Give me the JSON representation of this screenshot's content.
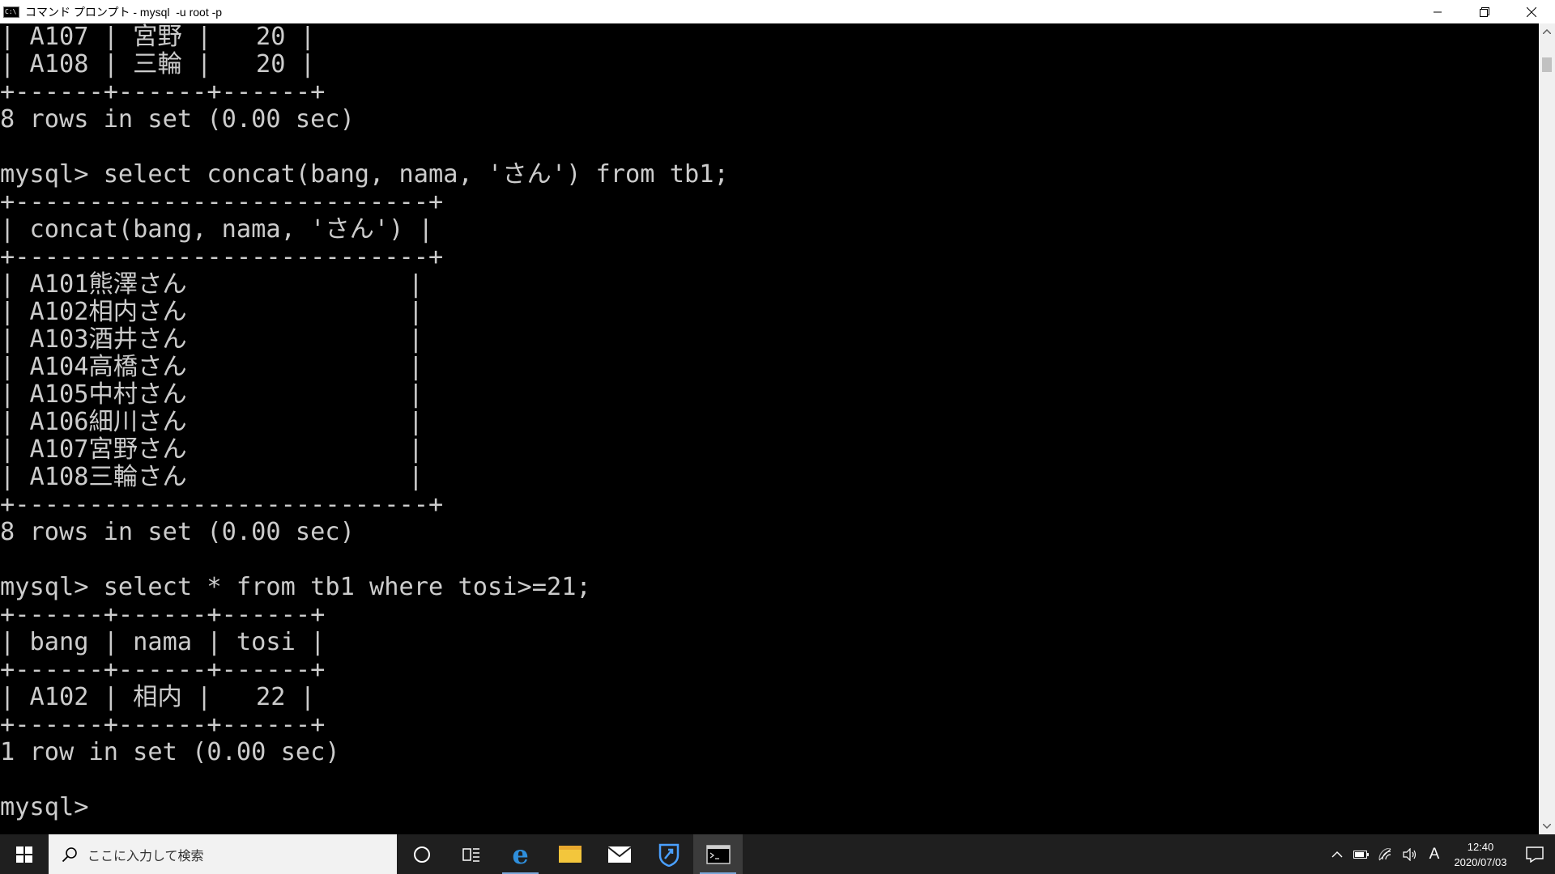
{
  "window": {
    "title": "コマンド プロンプト - mysql  -u root -p",
    "icon_label": "C:\\",
    "minimize_icon": "minimize-icon",
    "maximize_icon": "restore-icon",
    "close_icon": "close-icon"
  },
  "console": {
    "lines": [
      "| A107 | 宮野 |   20 |",
      "| A108 | 三輪 |   20 |",
      "+------+------+------+",
      "8 rows in set (0.00 sec)",
      "",
      "mysql> select concat(bang, nama, 'さん') from tb1;",
      "+----------------------------+",
      "| concat(bang, nama, 'さん') |",
      "+----------------------------+",
      "| A101熊澤さん               |",
      "| A102相内さん               |",
      "| A103酒井さん               |",
      "| A104高橋さん               |",
      "| A105中村さん               |",
      "| A106細川さん               |",
      "| A107宮野さん               |",
      "| A108三輪さん               |",
      "+----------------------------+",
      "8 rows in set (0.00 sec)",
      "",
      "mysql> select * from tb1 where tosi>=21;",
      "+------+------+------+",
      "| bang | nama | tosi |",
      "+------+------+------+",
      "| A102 | 相内 |   22 |",
      "+------+------+------+",
      "1 row in set (0.00 sec)",
      "",
      "mysql>"
    ]
  },
  "scrollbar": {
    "up_icon": "chevron-up-icon",
    "down_icon": "chevron-down-icon"
  },
  "taskbar": {
    "search_placeholder": "ここに入力して検索",
    "apps": [
      "cortana-icon",
      "task-view-icon",
      "edge-icon",
      "file-explorer-icon",
      "mail-icon",
      "security-icon",
      "command-prompt-icon"
    ],
    "tray": {
      "ime_label": "A",
      "time": "12:40",
      "date": "2020/07/03"
    }
  }
}
